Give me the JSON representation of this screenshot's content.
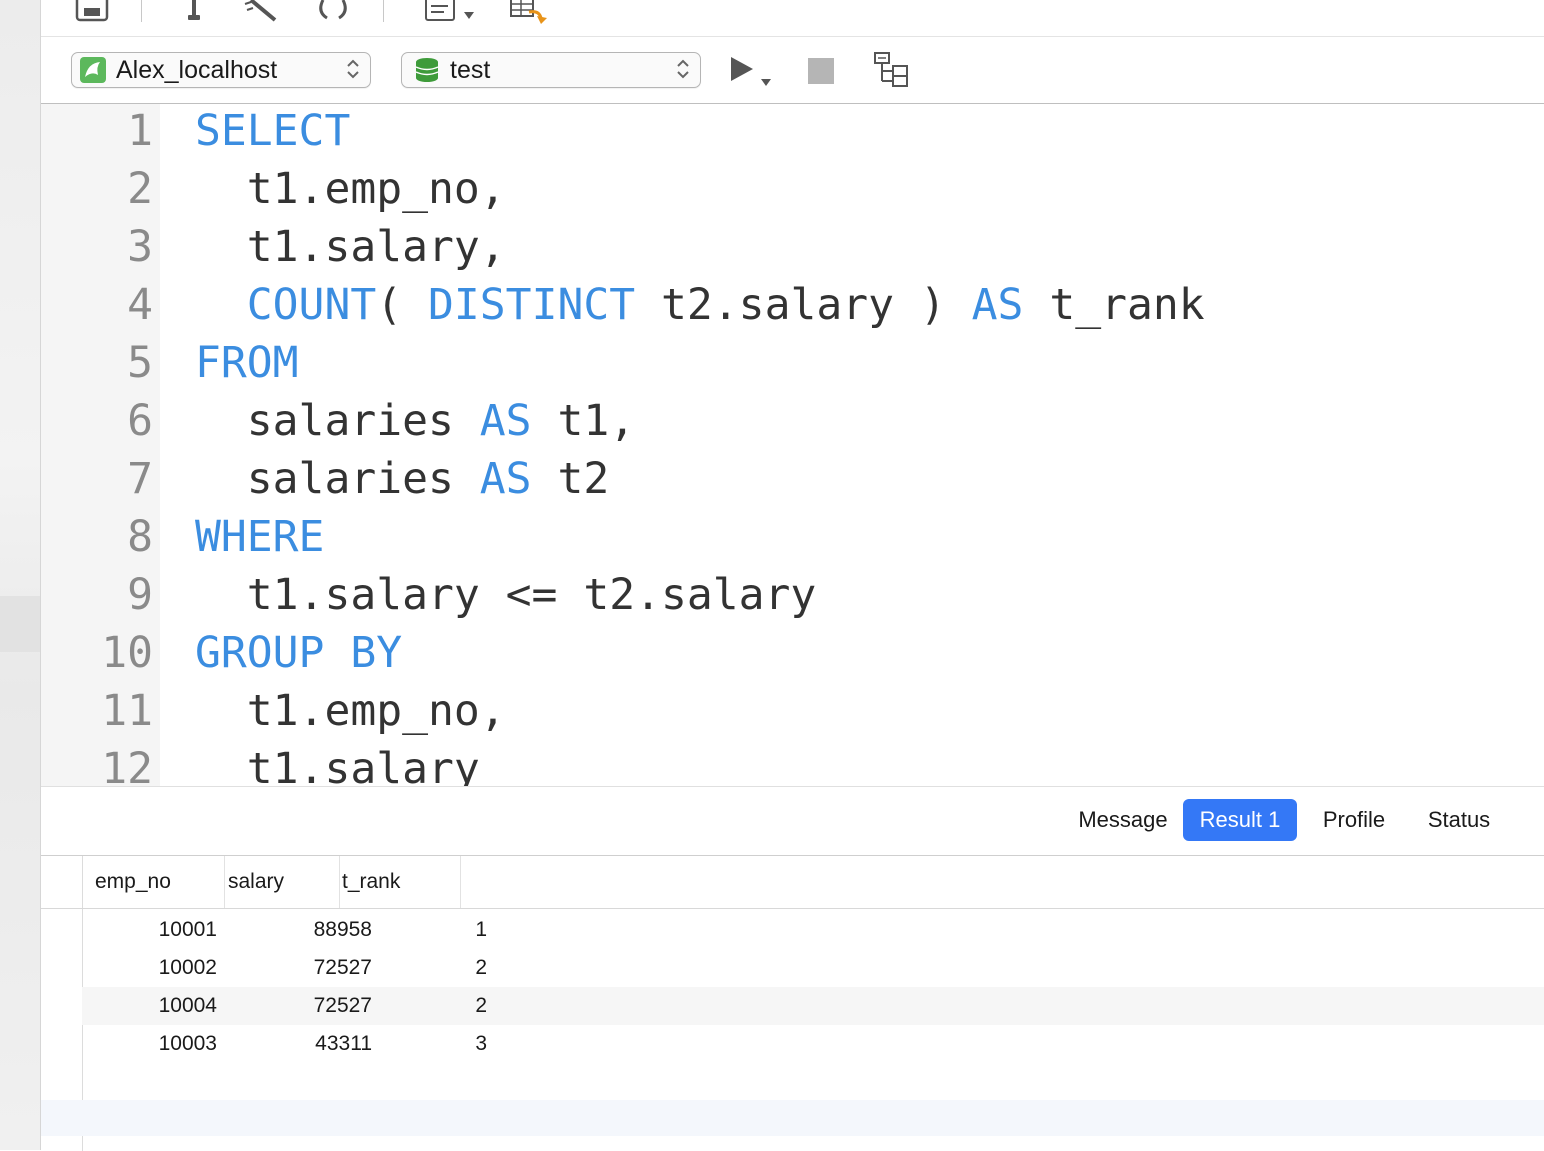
{
  "toolbar": {
    "icons": [
      "save-icon",
      "pin-icon",
      "magic-wand-icon",
      "refresh-icon",
      "text-format-icon",
      "table-export-icon"
    ]
  },
  "connection": {
    "name": "Alex_localhost"
  },
  "database": {
    "name": "test"
  },
  "editor": {
    "lines": [
      {
        "num": "1",
        "parts": [
          {
            "t": "SELECT",
            "kw": true
          }
        ]
      },
      {
        "num": "2",
        "parts": [
          {
            "t": "  t1.emp_no,",
            "kw": false
          }
        ]
      },
      {
        "num": "3",
        "parts": [
          {
            "t": "  t1.salary,",
            "kw": false
          }
        ]
      },
      {
        "num": "4",
        "parts": [
          {
            "t": "  ",
            "kw": false
          },
          {
            "t": "COUNT",
            "kw": true
          },
          {
            "t": "( ",
            "kw": false
          },
          {
            "t": "DISTINCT",
            "kw": true
          },
          {
            "t": " t2.salary ) ",
            "kw": false
          },
          {
            "t": "AS",
            "kw": true
          },
          {
            "t": " t_rank",
            "kw": false
          }
        ]
      },
      {
        "num": "5",
        "parts": [
          {
            "t": "FROM",
            "kw": true
          }
        ]
      },
      {
        "num": "6",
        "parts": [
          {
            "t": "  salaries ",
            "kw": false
          },
          {
            "t": "AS",
            "kw": true
          },
          {
            "t": " t1,",
            "kw": false
          }
        ]
      },
      {
        "num": "7",
        "parts": [
          {
            "t": "  salaries ",
            "kw": false
          },
          {
            "t": "AS",
            "kw": true
          },
          {
            "t": " t2",
            "kw": false
          }
        ]
      },
      {
        "num": "8",
        "parts": [
          {
            "t": "WHERE",
            "kw": true
          }
        ]
      },
      {
        "num": "9",
        "parts": [
          {
            "t": "  t1.salary <= t2.salary",
            "kw": false
          }
        ]
      },
      {
        "num": "10",
        "parts": [
          {
            "t": "GROUP BY",
            "kw": true
          }
        ]
      },
      {
        "num": "11",
        "parts": [
          {
            "t": "  t1.emp_no,",
            "kw": false
          }
        ]
      },
      {
        "num": "12",
        "parts": [
          {
            "t": "  t1.salary",
            "kw": false
          }
        ]
      }
    ]
  },
  "results": {
    "tabs": [
      {
        "label": "Message",
        "active": false
      },
      {
        "label": "Result 1",
        "active": true
      },
      {
        "label": "Profile",
        "active": false
      },
      {
        "label": "Status",
        "active": false
      }
    ],
    "columns": [
      "emp_no",
      "salary",
      "t_rank"
    ],
    "rows": [
      [
        "10001",
        "88958",
        "1"
      ],
      [
        "10002",
        "72527",
        "2"
      ],
      [
        "10004",
        "72527",
        "2"
      ],
      [
        "10003",
        "43311",
        "3"
      ]
    ]
  },
  "colors": {
    "keyword": "#3b8de0",
    "accent": "#3478f6"
  }
}
